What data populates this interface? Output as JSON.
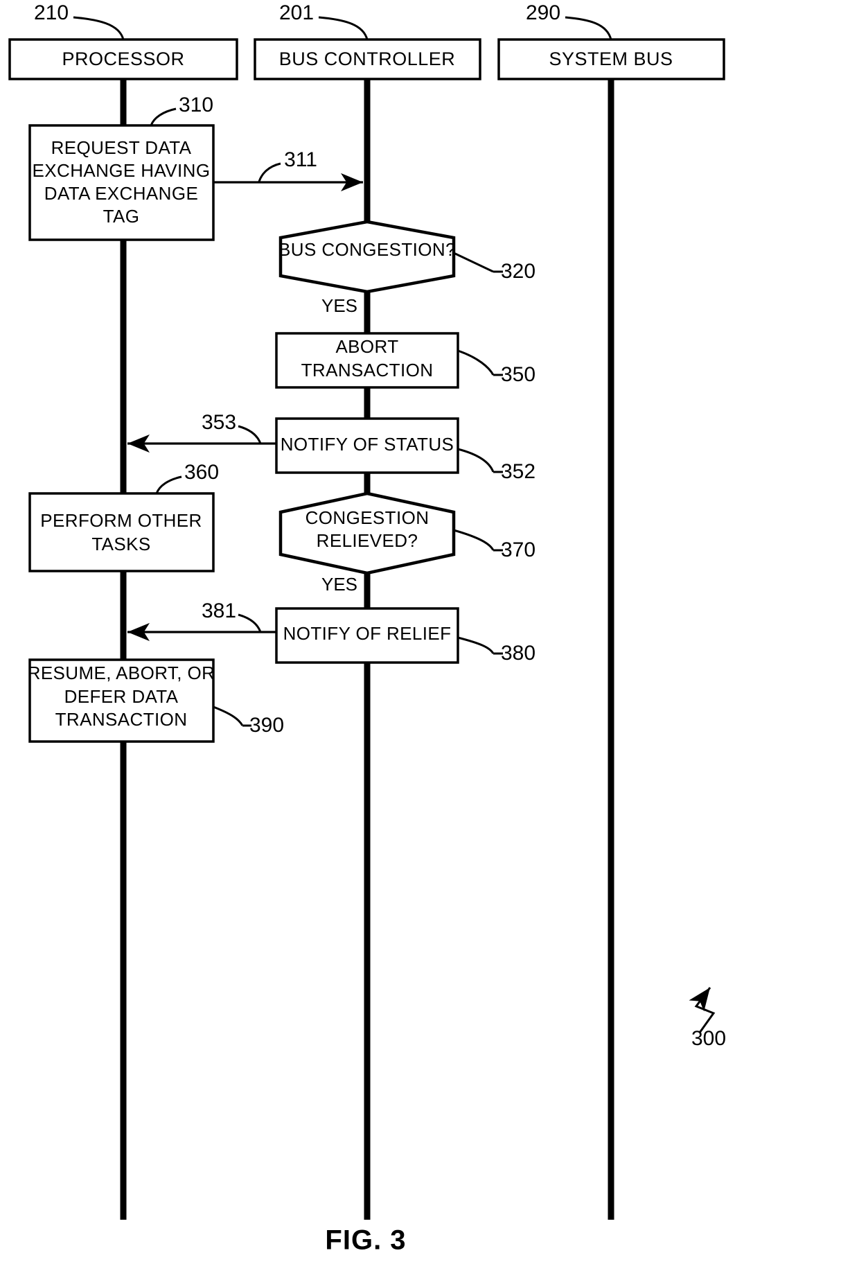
{
  "figure": {
    "caption": "FIG. 3",
    "diagram_ref": "300"
  },
  "lanes": [
    {
      "label": "PROCESSOR",
      "ref": "210"
    },
    {
      "label": "BUS CONTROLLER",
      "ref": "201"
    },
    {
      "label": "SYSTEM BUS",
      "ref": "290"
    }
  ],
  "nodes": {
    "request": {
      "line1": "REQUEST DATA",
      "line2": "EXCHANGE HAVING",
      "line3": "DATA EXCHANGE",
      "line4": "TAG",
      "ref": "310"
    },
    "request_arrow": {
      "ref": "311"
    },
    "bus_congestion": {
      "label": "BUS CONGESTION?",
      "ref": "320",
      "branch": "YES"
    },
    "abort": {
      "line1": "ABORT",
      "line2": "TRANSACTION",
      "ref": "350"
    },
    "notify_status": {
      "label": "NOTIFY OF STATUS",
      "ref": "352",
      "arrow_ref": "353"
    },
    "other_tasks": {
      "line1": "PERFORM OTHER",
      "line2": "TASKS",
      "ref": "360"
    },
    "congestion_relieved": {
      "line1": "CONGESTION",
      "line2": "RELIEVED?",
      "ref": "370",
      "branch": "YES"
    },
    "notify_relief": {
      "label": "NOTIFY OF RELIEF",
      "ref": "380",
      "arrow_ref": "381"
    },
    "resume": {
      "line1": "RESUME, ABORT, OR",
      "line2": "DEFER DATA",
      "line3": "TRANSACTION",
      "ref": "390"
    }
  },
  "colors": {
    "stroke": "#000000",
    "fill": "#ffffff"
  }
}
